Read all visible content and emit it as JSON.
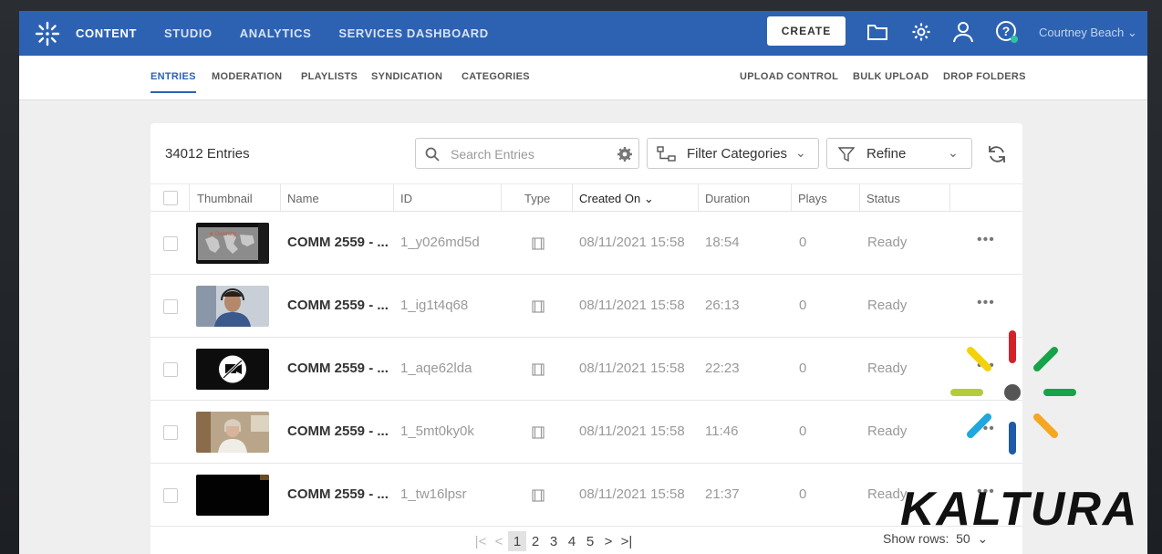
{
  "topnav": {
    "items": [
      {
        "label": "CONTENT",
        "active": true
      },
      {
        "label": "STUDIO"
      },
      {
        "label": "ANALYTICS"
      },
      {
        "label": "SERVICES DASHBOARD"
      }
    ],
    "create_label": "CREATE",
    "icons": [
      "folder-icon",
      "gear-icon",
      "user-icon",
      "help-icon"
    ],
    "user_name": "Courtney Beach"
  },
  "subnav": {
    "left": [
      "ENTRIES",
      "MODERATION",
      "PLAYLISTS",
      "SYNDICATION",
      "CATEGORIES"
    ],
    "right": [
      "UPLOAD CONTROL",
      "BULK UPLOAD",
      "DROP FOLDERS"
    ]
  },
  "toolbar": {
    "count": "34012 Entries",
    "search_placeholder": "Search Entries",
    "filter_categories": "Filter Categories",
    "refine": "Refine"
  },
  "table": {
    "headers": [
      "Thumbnail",
      "Name",
      "ID",
      "Type",
      "Created On",
      "Duration",
      "Plays",
      "Status"
    ],
    "rows": [
      {
        "name": "COMM 2559 - ...",
        "id": "1_y026md5d",
        "created": "08/11/2021 15:58",
        "duration": "18:54",
        "plays": "0",
        "status": "Ready",
        "thumb": "map"
      },
      {
        "name": "COMM 2559 - ...",
        "id": "1_ig1t4q68",
        "created": "08/11/2021 15:58",
        "duration": "26:13",
        "plays": "0",
        "status": "Ready",
        "thumb": "man"
      },
      {
        "name": "COMM 2559 - ...",
        "id": "1_aqe62lda",
        "created": "08/11/2021 15:58",
        "duration": "22:23",
        "plays": "0",
        "status": "Ready",
        "thumb": "novideo"
      },
      {
        "name": "COMM 2559 - ...",
        "id": "1_5mt0ky0k",
        "created": "08/11/2021 15:58",
        "duration": "11:46",
        "plays": "0",
        "status": "Ready",
        "thumb": "woman"
      },
      {
        "name": "COMM 2559 - ...",
        "id": "1_tw16lpsr",
        "created": "08/11/2021 15:58",
        "duration": "21:37",
        "plays": "0",
        "status": "Ready",
        "thumb": "black"
      }
    ]
  },
  "pager": {
    "pages": [
      "1",
      "2",
      "3",
      "4",
      "5"
    ],
    "current": "1",
    "show_rows_label": "Show rows:",
    "show_rows_value": "50"
  },
  "brand": {
    "wordmark": "KALTURA",
    "colors": [
      "#d3232a",
      "#16a34a",
      "#f5a623",
      "#1e5aa8",
      "#1ea7e1",
      "#f4d20b",
      "#b5cc3a",
      "#555555"
    ]
  },
  "colors": {
    "nav_bg": "#2d62b3",
    "accent": "#2d62b3"
  }
}
